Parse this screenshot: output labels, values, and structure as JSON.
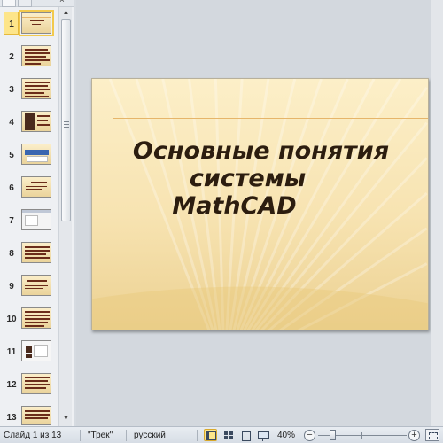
{
  "thumbnails": [
    {
      "number": "1"
    },
    {
      "number": "2"
    },
    {
      "number": "3"
    },
    {
      "number": "4"
    },
    {
      "number": "5"
    },
    {
      "number": "6"
    },
    {
      "number": "7"
    },
    {
      "number": "8"
    },
    {
      "number": "9"
    },
    {
      "number": "10"
    },
    {
      "number": "11"
    },
    {
      "number": "12"
    },
    {
      "number": "13"
    }
  ],
  "slide": {
    "title_lines": [
      "Основные понятия",
      "системы",
      "MathCAD"
    ]
  },
  "status": {
    "slide_counter": "Слайд 1 из 13",
    "theme": "\"Трек\"",
    "language": "русский",
    "zoom": "40%",
    "zoom_out": "−",
    "zoom_in": "+"
  },
  "icons": {
    "pane_close": "close-icon",
    "scroll_up": "arrow-up-icon",
    "scroll_down": "arrow-down-icon"
  },
  "colors": {
    "selection": "#fde58a",
    "slide_title": "#2c1d0f",
    "slide_bg": "#f7e3b1"
  }
}
